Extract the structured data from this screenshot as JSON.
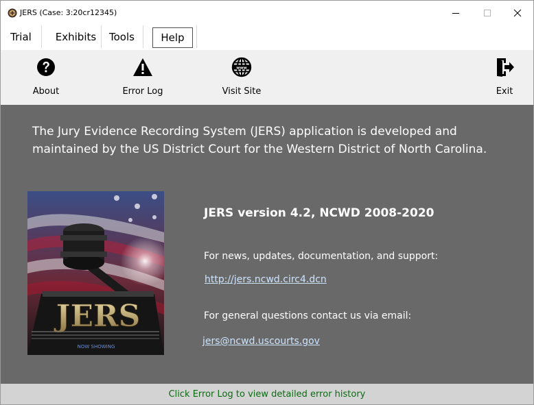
{
  "window": {
    "title": "JERS (Case: 3:20cr12345)"
  },
  "menu": {
    "items": [
      {
        "label": "Trial"
      },
      {
        "label": "Exhibits"
      },
      {
        "label": "Tools"
      },
      {
        "label": "Help"
      }
    ],
    "active": "Help"
  },
  "toolbar": {
    "about_label": "About",
    "error_log_label": "Error Log",
    "visit_site_label": "Visit Site",
    "exit_label": "Exit",
    "icons": {
      "about": "question-circle-icon",
      "error_log": "warning-triangle-icon",
      "visit_site": "www-globe-icon",
      "exit": "exit-door-icon"
    }
  },
  "about": {
    "intro": "The Jury Evidence Recording System (JERS) application is developed and maintained by the US District Court for the Western District of North Carolina.",
    "version": "JERS version 4.2, NCWD 2008-2020",
    "news_text": "For news, updates, documentation, and support:",
    "site_link": "http://jers.ncwd.circ4.dcn",
    "email_text": "For general questions contact us via email:",
    "email_link": "jers@ncwd.uscourts.gov",
    "poster_logo_text": "JERS",
    "poster_tagline": "NOW SHOWING"
  },
  "status": {
    "message": "Click Error Log to view detailed error history"
  },
  "colors": {
    "content_bg": "#696969",
    "toolbar_bg": "#f0f0f0",
    "status_bg": "#d3d3d3",
    "status_text": "#0b6b12",
    "link": "#cde4ff"
  }
}
